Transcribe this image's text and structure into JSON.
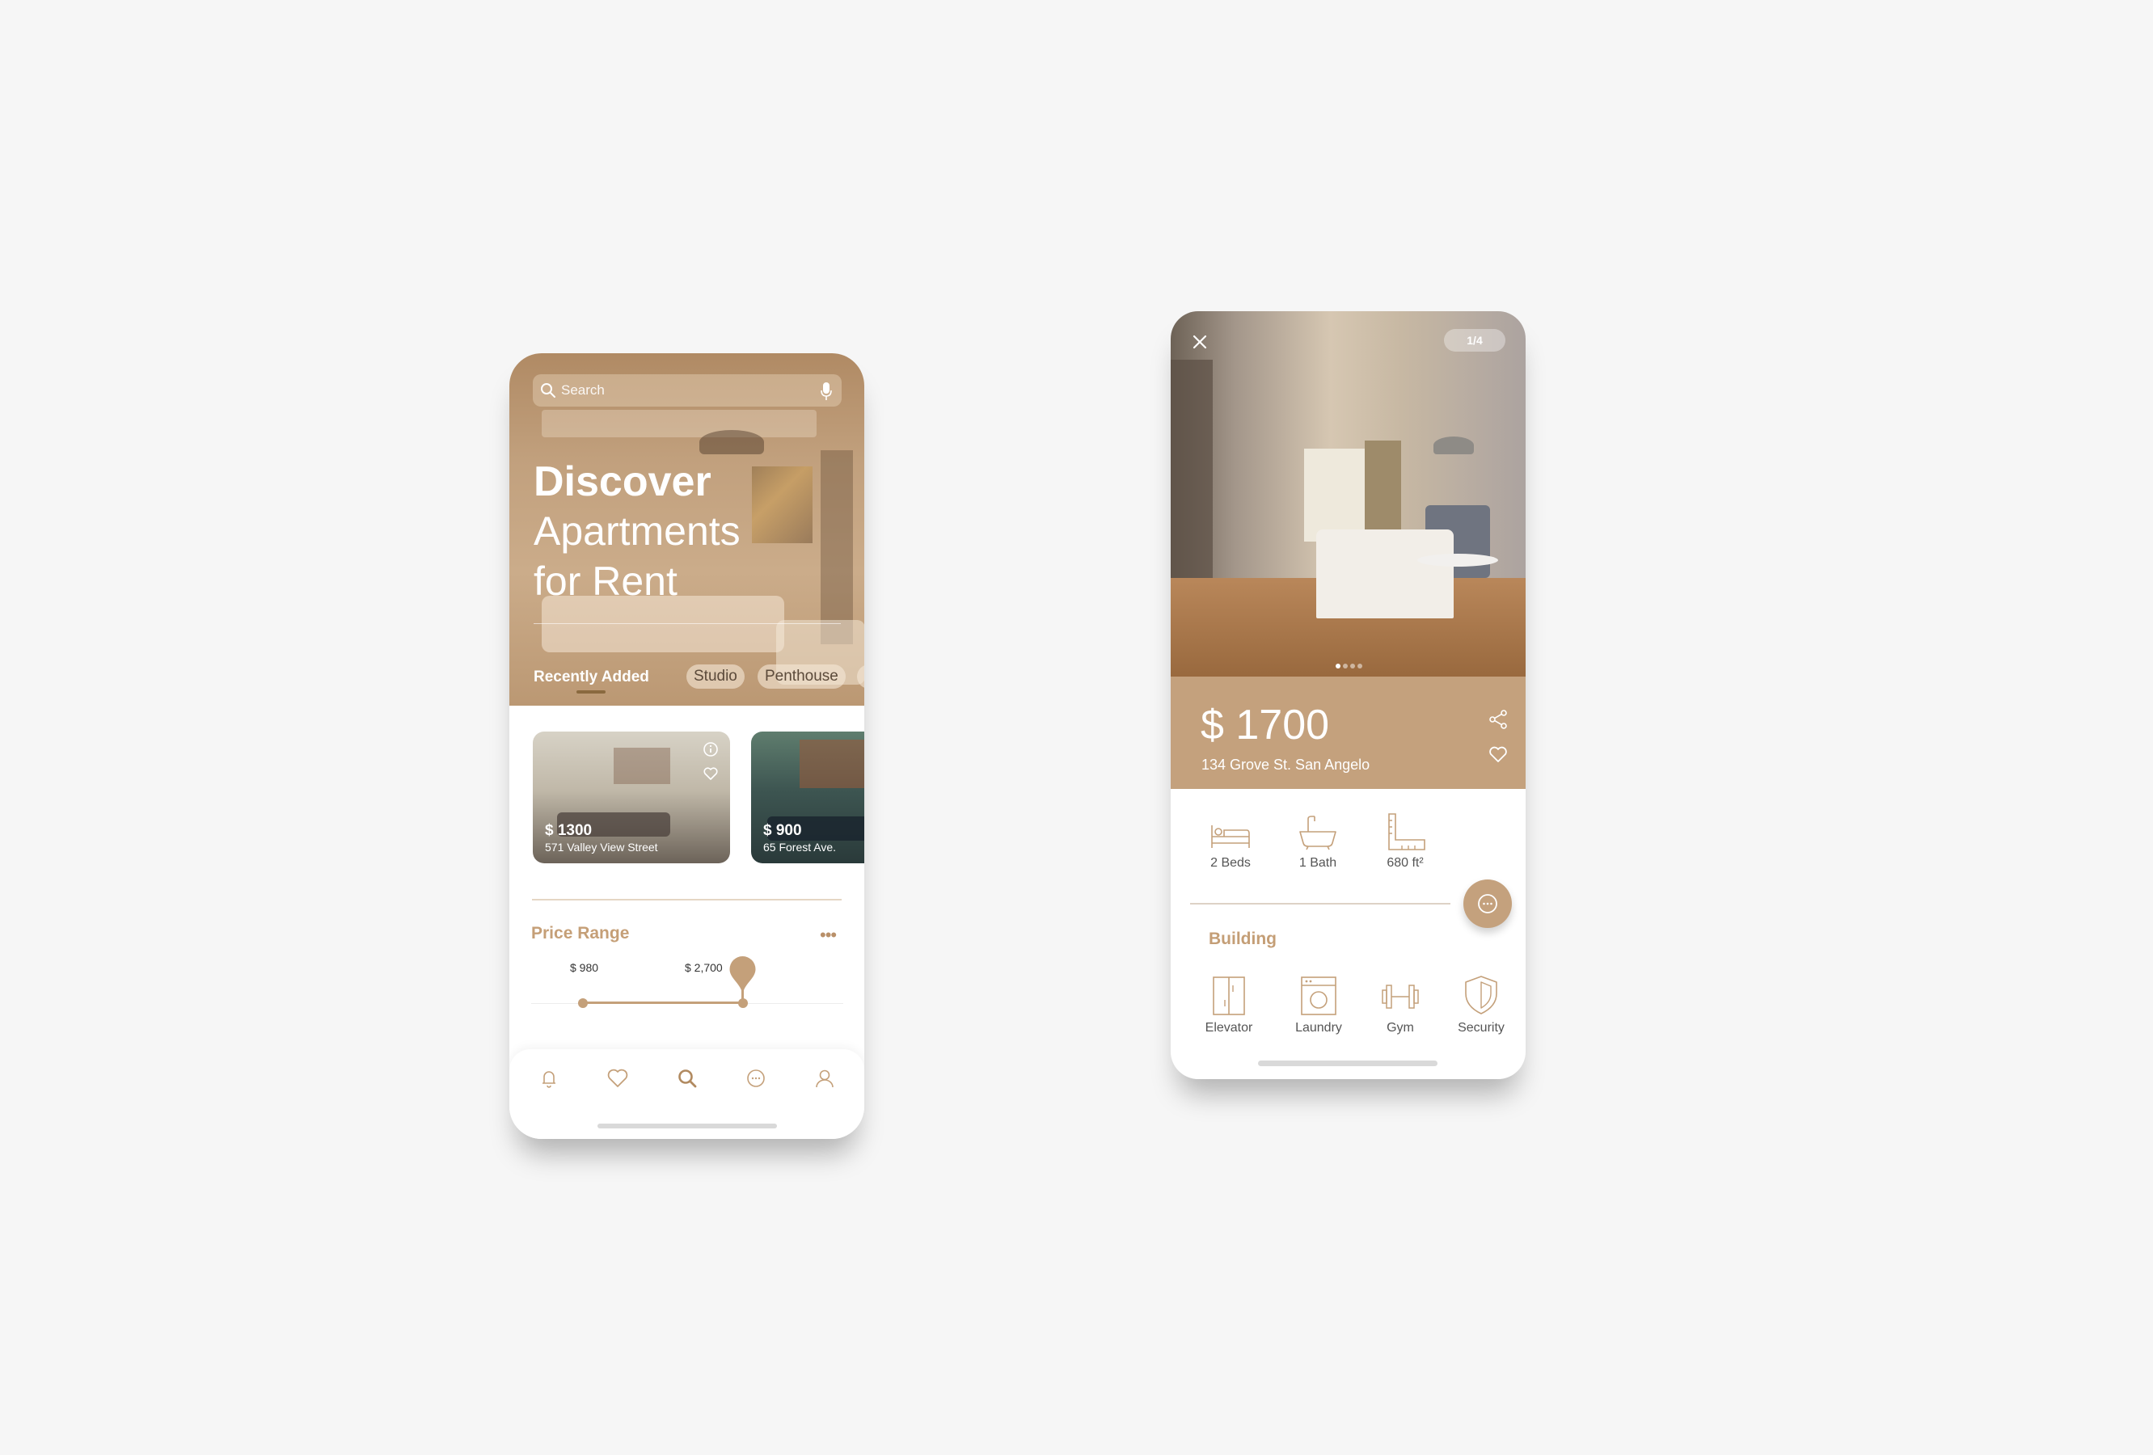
{
  "home": {
    "search": {
      "placeholder": "Search"
    },
    "headline": {
      "line1": "Discover",
      "line2": "Apartments",
      "line3": "for Rent"
    },
    "filters": {
      "active": "Recently Added",
      "chips": [
        "Studio",
        "Penthouse"
      ]
    },
    "listings": [
      {
        "price": "$ 1300",
        "address": "571 Valley View Street"
      },
      {
        "price": "$ 900",
        "address": "65 Forest Ave."
      }
    ],
    "price_range": {
      "title": "Price Range",
      "more": "•••",
      "min_label": "$ 980",
      "max_label": "$ 2,700"
    },
    "tabbar": [
      "bell-icon",
      "heart-icon",
      "search-icon",
      "chat-icon",
      "user-icon"
    ]
  },
  "detail": {
    "photo_counter": "1/4",
    "price": "$ 1700",
    "address": "134 Grove St. San Angelo",
    "features": [
      {
        "icon": "bed-icon",
        "label": "2 Beds"
      },
      {
        "icon": "bath-icon",
        "label": "1 Bath"
      },
      {
        "icon": "ruler-icon",
        "label": "680 ft²"
      }
    ],
    "building_title": "Building",
    "amenities": [
      {
        "icon": "elevator-icon",
        "label": "Elevator"
      },
      {
        "icon": "laundry-icon",
        "label": "Laundry"
      },
      {
        "icon": "gym-icon",
        "label": "Gym"
      },
      {
        "icon": "security-icon",
        "label": "Security"
      }
    ]
  },
  "colors": {
    "accent": "#c4a17d",
    "accent_text": "#c59f77",
    "background": "#f6f6f6"
  }
}
